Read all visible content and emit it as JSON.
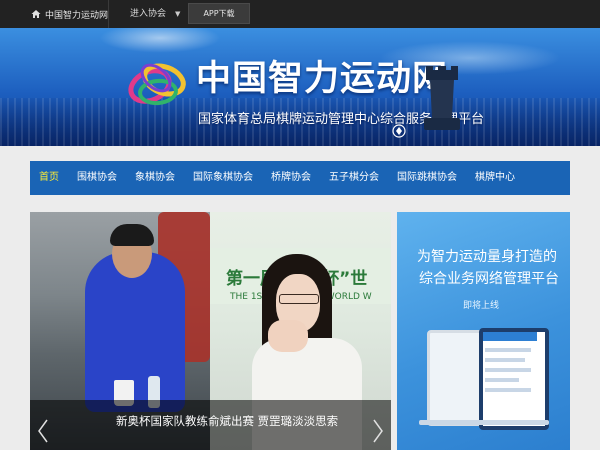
{
  "topbar": {
    "home_label": "中国智力运动网",
    "enter_association": "进入协会",
    "dropdown_caret": "▼",
    "app_download": "APP下载"
  },
  "banner": {
    "title": "中国智力运动网",
    "subtitle": "国家体育总局棋牌运动管理中心综合服务管理平台"
  },
  "nav": {
    "items": [
      "首页",
      "围棋协会",
      "象棋协会",
      "国际象棋协会",
      "桥牌协会",
      "五子棋分会",
      "国际跳棋协会",
      "棋牌中心"
    ],
    "active_index": 0
  },
  "slider": {
    "caption": "新奥杯国家队教练俞斌出赛 贾罡璐淡淡思索",
    "photo_text_large": "第一届“新奥杯”世",
    "photo_text_small": "THE 1ST XIN'AO CUP WORLD W"
  },
  "promo": {
    "line1": "为智力运动量身打造的",
    "line2": "综合业务网络管理平台",
    "coming_soon": "即将上线"
  },
  "colors": {
    "nav_bg": "#1a64b5",
    "nav_active": "#ffee33",
    "topbar_bg": "#222222",
    "promo_bg": "#3c92dc"
  }
}
